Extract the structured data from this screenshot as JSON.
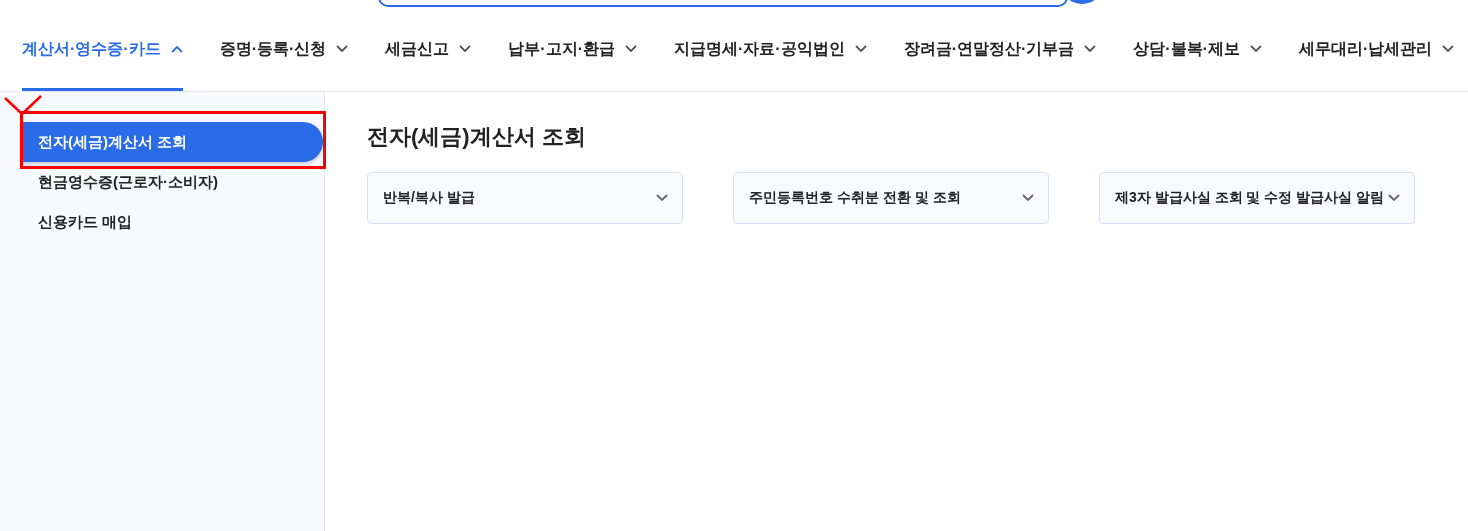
{
  "nav": [
    {
      "label": "계산서·영수증·카드",
      "selected": true
    },
    {
      "label": "증명·등록·신청",
      "selected": false
    },
    {
      "label": "세금신고",
      "selected": false
    },
    {
      "label": "납부·고지·환급",
      "selected": false
    },
    {
      "label": "지급명세·자료·공익법인",
      "selected": false
    },
    {
      "label": "장려금·연말정산·기부금",
      "selected": false
    },
    {
      "label": "상담·불복·제보",
      "selected": false
    },
    {
      "label": "세무대리·납세관리",
      "selected": false
    }
  ],
  "sidebar": {
    "items": [
      {
        "label": "전자(세금)계산서 조회",
        "selected": true
      },
      {
        "label": "현금영수증(근로자·소비자)",
        "selected": false
      },
      {
        "label": "신용카드 매입",
        "selected": false
      }
    ]
  },
  "page_title": "전자(세금)계산서 조회",
  "sections": [
    {
      "label": "반복/복사 발급",
      "expanded": false
    },
    {
      "label": "주민등록번호 수취분 전환 및 조회",
      "expanded": false
    },
    {
      "label": "제3자 발급사실 조회 및 수정 발급사실 알림",
      "expanded": false
    }
  ],
  "annotation": {
    "check_mark": true,
    "highlight_box": true
  }
}
